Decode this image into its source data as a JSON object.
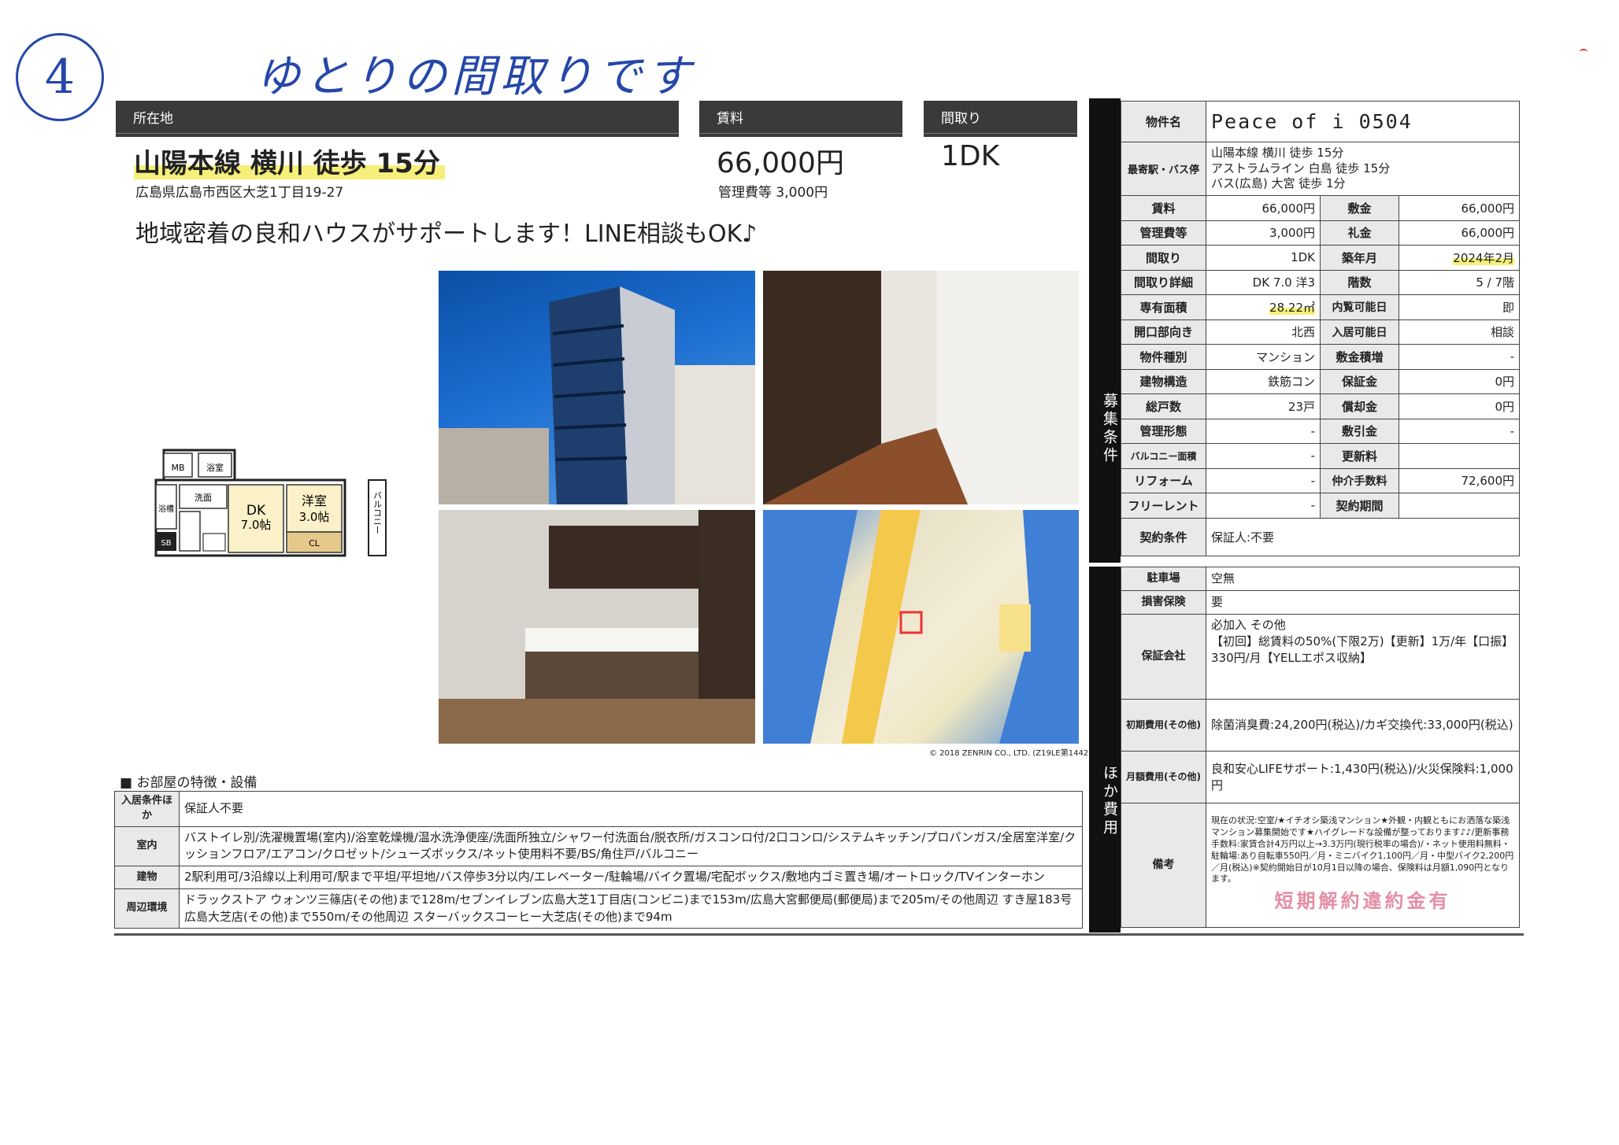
{
  "handwriting": {
    "number": "4",
    "note": "ゆとりの間取りです"
  },
  "header": {
    "location_label": "所在地",
    "rent_label": "賃料",
    "layout_label": "間取り"
  },
  "summary": {
    "access": "山陽本線 横川 徒歩 15分",
    "address": "広島県広島市西区大芝1丁目19-27",
    "rent": "66,000円",
    "management_fee": "管理費等 3,000円",
    "layout": "1DK",
    "catchphrase": "地域密着の良和ハウスがサポートします！LINE相談もOK♪"
  },
  "floorplan": {
    "mb": "MB",
    "bath": "浴室",
    "wash": "洗面",
    "toilet": "浴槽",
    "sb": "SB",
    "dk_name": "DK",
    "dk_size": "7.0帖",
    "room_name": "洋室",
    "room_size": "3.0帖",
    "closet": "CL",
    "balcony": "バルコニー"
  },
  "map_credit": "© 2018 ZENRIN CO., LTD. (Z19LE第1442号)",
  "features": {
    "title": "■ お部屋の特徴・設備",
    "rows": [
      {
        "label": "入居条件ほか",
        "value": "保証人不要"
      },
      {
        "label": "室内",
        "value": "バストイレ別/洗濯機置場(室内)/浴室乾燥機/温水洗浄便座/洗面所独立/シャワー付洗面台/脱衣所/ガスコンロ付/2口コンロ/システムキッチン/プロパンガス/全居室洋室/クッションフロア/エアコン/クロゼット/シューズボックス/ネット使用料不要/BS/角住戸/バルコニー"
      },
      {
        "label": "建物",
        "value": "2駅利用可/3沿線以上利用可/駅まで平坦/平坦地/バス停歩3分以内/エレベーター/駐輪場/バイク置場/宅配ボックス/敷地内ゴミ置き場/オートロック/TVインターホン"
      },
      {
        "label": "周辺環境",
        "value": "ドラックストア ウォンツ三篠店(その他)まで128m/セブンイレブン広島大芝1丁目店(コンビニ)まで153m/広島大宮郵便局(郵便局)まで205m/その他周辺 すき屋183号広島大芝店(その他)まで550m/その他周辺 スターバックスコーヒー大芝店(その他)まで94m"
      }
    ]
  },
  "side_labels": {
    "recruit": "募集条件",
    "other": "ほか費用"
  },
  "property": {
    "name_label": "物件名",
    "name": "Peace of i 0504",
    "station_label": "最寄駅・バス停",
    "stations": [
      "山陽本線 横川 徒歩 15分",
      "アストラムライン 白島 徒歩 15分",
      "バス(広島) 大宮 徒歩 1分"
    ],
    "grid": [
      [
        "賃料",
        "66,000円",
        "敷金",
        "66,000円"
      ],
      [
        "管理費等",
        "3,000円",
        "礼金",
        "66,000円"
      ],
      [
        "間取り",
        "1DK",
        "築年月",
        "2024年2月"
      ],
      [
        "間取り詳細",
        "DK 7.0 洋3",
        "階数",
        "5 / 7階"
      ],
      [
        "専有面積",
        "28.22㎡",
        "内覧可能日",
        "即"
      ],
      [
        "開口部向き",
        "北西",
        "入居可能日",
        "相談"
      ],
      [
        "物件種別",
        "マンション",
        "敷金積増",
        "-"
      ],
      [
        "建物構造",
        "鉄筋コン",
        "保証金",
        "0円"
      ],
      [
        "総戸数",
        "23戸",
        "償却金",
        "0円"
      ],
      [
        "管理形態",
        "-",
        "敷引金",
        "-"
      ],
      [
        "バルコニー面積",
        "-",
        "更新料",
        ""
      ],
      [
        "リフォーム",
        "-",
        "仲介手数料",
        "72,600円"
      ],
      [
        "フリーレント",
        "-",
        "契約期間",
        ""
      ]
    ],
    "contract_label": "契約条件",
    "contract": "保証人:不要"
  },
  "costs": {
    "rows": [
      {
        "label": "駐車場",
        "value": "空無"
      },
      {
        "label": "損害保険",
        "value": "要"
      },
      {
        "label": "保証会社",
        "value": "必加入 その他\n【初回】総賃料の50%(下限2万)【更新】1万/年【口振】330円/月【YELLエポス収納】"
      },
      {
        "label": "初期費用(その他)",
        "value": "除菌消臭費:24,200円(税込)/カギ交換代:33,000円(税込)"
      },
      {
        "label": "月額費用(その他)",
        "value": "良和安心LIFEサポート:1,430円(税込)/火災保険料:1,000円"
      }
    ],
    "remarks_label": "備考",
    "remarks": "現在の状況:空室/★イチオシ築浅マンション★外観・内観ともにお洒落な築浅マンション募集開始です★ハイグレードな設備が整っております♪♪/更新事務手数料:家賃合計4万円以上→3.3万円(現行税率の場合)/・ネット使用料無料・駐輪場:あり自転車550円／月・ミニバイク1,100円／月・中型バイク2,200円／月(税込)※契約開始日が10月1日以降の場合、保険料は月額1,090円となります。",
    "stamp": "短期解約違約金有"
  },
  "colors": {
    "header_bg": "#3a3a3a",
    "highlight": "#f6f07a",
    "handwriting": "#2547a8",
    "stamp": "#e07a95"
  }
}
